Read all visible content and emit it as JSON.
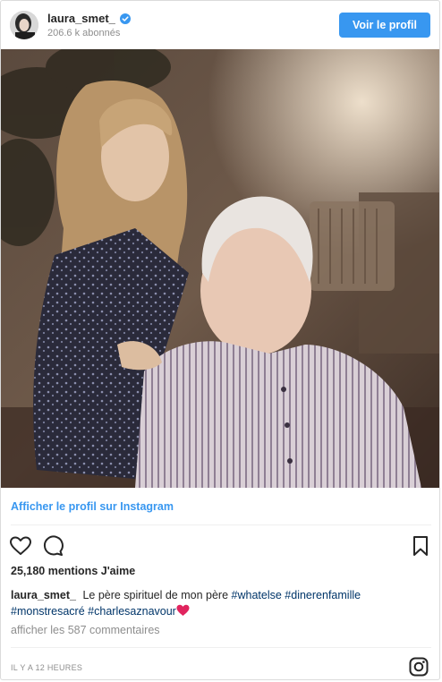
{
  "header": {
    "username": "laura_smet_",
    "followers": "206.6 k abonnés",
    "profile_button": "Voir le profil",
    "verified_icon": "verified-badge-icon"
  },
  "post": {
    "view_on_instagram": "Afficher le profil sur Instagram",
    "likes": "25,180 mentions J'aime",
    "caption": {
      "user": "laura_smet_",
      "text": " Le père spirituel de mon père ",
      "tags": [
        "#whatelse",
        "#dinerenfamille",
        "#monstresacré",
        "#charlesaznavour"
      ]
    },
    "view_comments": "afficher les 587 commentaires",
    "timestamp": "IL Y A 12 HEURES"
  },
  "icons": {
    "like": "heart-outline-icon",
    "comment": "comment-bubble-icon",
    "save": "bookmark-icon",
    "caption_emoji": "red-heart-icon",
    "brand": "instagram-logo-icon"
  },
  "colors": {
    "accent": "#3897f0",
    "hashtag": "#003569",
    "muted": "#8e8e8e",
    "heart_emoji": "#e0245e"
  }
}
